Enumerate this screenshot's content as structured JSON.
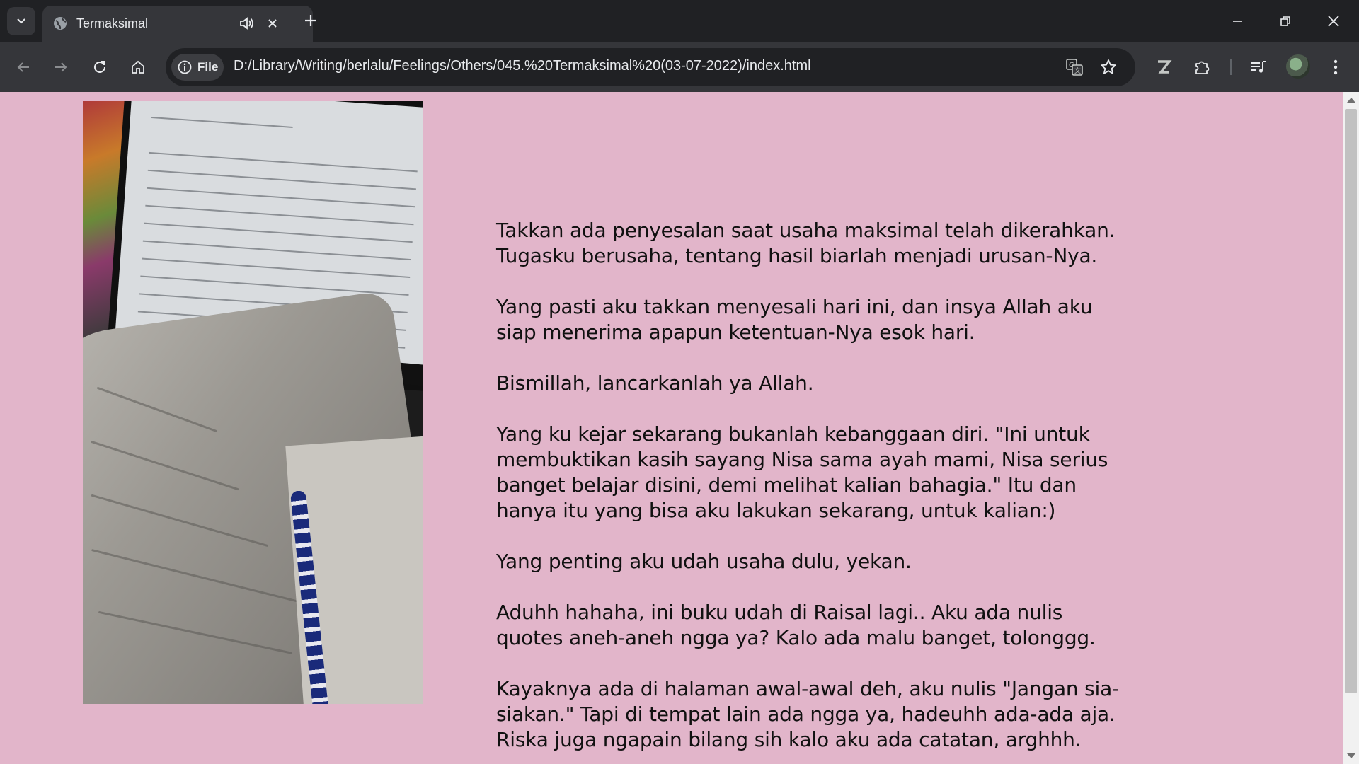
{
  "browser": {
    "tab": {
      "title": "Termaksimal"
    },
    "omnibox": {
      "site_chip_label": "File",
      "url": "D:/Library/Writing/berlalu/Feelings/Others/045.%20Termaksimal%20(03-07-2022)/index.html"
    }
  },
  "page": {
    "background_color": "#e2b5ca",
    "paragraphs": [
      "Takkan ada penyesalan saat usaha maksimal telah dikerahkan. Tugasku berusaha, tentang hasil biarlah menjadi urusan-Nya.",
      "Yang pasti aku takkan menyesali hari ini, dan insya Allah aku siap menerima apapun ketentuan-Nya esok hari.",
      "Bismillah, lancarkanlah ya Allah.",
      "Yang ku kejar sekarang bukanlah kebanggaan diri. \"Ini untuk membuktikan kasih sayang Nisa sama ayah mami, Nisa serius banget belajar disini, demi melihat kalian bahagia.\" Itu dan hanya itu yang bisa aku lakukan sekarang, untuk kalian:)",
      "Yang penting aku udah usaha dulu, yekan.",
      "Aduhh hahaha, ini buku udah di Raisal lagi.. Aku ada nulis quotes aneh-aneh ngga ya? Kalo ada malu banget, tolonggg.",
      "Kayaknya ada di halaman awal-awal deh, aku nulis \"Jangan sia-siakan.\" Tapi di tempat lain ada ngga ya, hadeuhh ada-ada aja. Riska juga ngapain bilang sih kalo aku ada catatan, arghhh."
    ]
  }
}
